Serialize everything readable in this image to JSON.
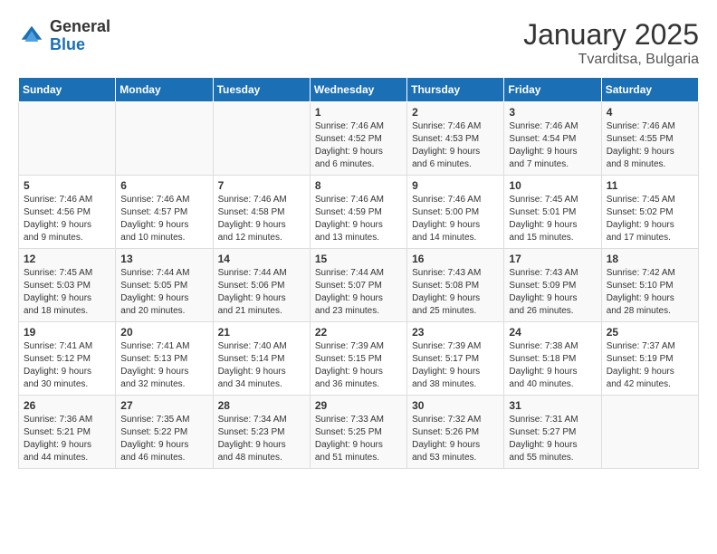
{
  "header": {
    "logo_general": "General",
    "logo_blue": "Blue",
    "title": "January 2025",
    "location": "Tvarditsa, Bulgaria"
  },
  "days_of_week": [
    "Sunday",
    "Monday",
    "Tuesday",
    "Wednesday",
    "Thursday",
    "Friday",
    "Saturday"
  ],
  "weeks": [
    [
      {
        "day": "",
        "info": ""
      },
      {
        "day": "",
        "info": ""
      },
      {
        "day": "",
        "info": ""
      },
      {
        "day": "1",
        "info": "Sunrise: 7:46 AM\nSunset: 4:52 PM\nDaylight: 9 hours\nand 6 minutes."
      },
      {
        "day": "2",
        "info": "Sunrise: 7:46 AM\nSunset: 4:53 PM\nDaylight: 9 hours\nand 6 minutes."
      },
      {
        "day": "3",
        "info": "Sunrise: 7:46 AM\nSunset: 4:54 PM\nDaylight: 9 hours\nand 7 minutes."
      },
      {
        "day": "4",
        "info": "Sunrise: 7:46 AM\nSunset: 4:55 PM\nDaylight: 9 hours\nand 8 minutes."
      }
    ],
    [
      {
        "day": "5",
        "info": "Sunrise: 7:46 AM\nSunset: 4:56 PM\nDaylight: 9 hours\nand 9 minutes."
      },
      {
        "day": "6",
        "info": "Sunrise: 7:46 AM\nSunset: 4:57 PM\nDaylight: 9 hours\nand 10 minutes."
      },
      {
        "day": "7",
        "info": "Sunrise: 7:46 AM\nSunset: 4:58 PM\nDaylight: 9 hours\nand 12 minutes."
      },
      {
        "day": "8",
        "info": "Sunrise: 7:46 AM\nSunset: 4:59 PM\nDaylight: 9 hours\nand 13 minutes."
      },
      {
        "day": "9",
        "info": "Sunrise: 7:46 AM\nSunset: 5:00 PM\nDaylight: 9 hours\nand 14 minutes."
      },
      {
        "day": "10",
        "info": "Sunrise: 7:45 AM\nSunset: 5:01 PM\nDaylight: 9 hours\nand 15 minutes."
      },
      {
        "day": "11",
        "info": "Sunrise: 7:45 AM\nSunset: 5:02 PM\nDaylight: 9 hours\nand 17 minutes."
      }
    ],
    [
      {
        "day": "12",
        "info": "Sunrise: 7:45 AM\nSunset: 5:03 PM\nDaylight: 9 hours\nand 18 minutes."
      },
      {
        "day": "13",
        "info": "Sunrise: 7:44 AM\nSunset: 5:05 PM\nDaylight: 9 hours\nand 20 minutes."
      },
      {
        "day": "14",
        "info": "Sunrise: 7:44 AM\nSunset: 5:06 PM\nDaylight: 9 hours\nand 21 minutes."
      },
      {
        "day": "15",
        "info": "Sunrise: 7:44 AM\nSunset: 5:07 PM\nDaylight: 9 hours\nand 23 minutes."
      },
      {
        "day": "16",
        "info": "Sunrise: 7:43 AM\nSunset: 5:08 PM\nDaylight: 9 hours\nand 25 minutes."
      },
      {
        "day": "17",
        "info": "Sunrise: 7:43 AM\nSunset: 5:09 PM\nDaylight: 9 hours\nand 26 minutes."
      },
      {
        "day": "18",
        "info": "Sunrise: 7:42 AM\nSunset: 5:10 PM\nDaylight: 9 hours\nand 28 minutes."
      }
    ],
    [
      {
        "day": "19",
        "info": "Sunrise: 7:41 AM\nSunset: 5:12 PM\nDaylight: 9 hours\nand 30 minutes."
      },
      {
        "day": "20",
        "info": "Sunrise: 7:41 AM\nSunset: 5:13 PM\nDaylight: 9 hours\nand 32 minutes."
      },
      {
        "day": "21",
        "info": "Sunrise: 7:40 AM\nSunset: 5:14 PM\nDaylight: 9 hours\nand 34 minutes."
      },
      {
        "day": "22",
        "info": "Sunrise: 7:39 AM\nSunset: 5:15 PM\nDaylight: 9 hours\nand 36 minutes."
      },
      {
        "day": "23",
        "info": "Sunrise: 7:39 AM\nSunset: 5:17 PM\nDaylight: 9 hours\nand 38 minutes."
      },
      {
        "day": "24",
        "info": "Sunrise: 7:38 AM\nSunset: 5:18 PM\nDaylight: 9 hours\nand 40 minutes."
      },
      {
        "day": "25",
        "info": "Sunrise: 7:37 AM\nSunset: 5:19 PM\nDaylight: 9 hours\nand 42 minutes."
      }
    ],
    [
      {
        "day": "26",
        "info": "Sunrise: 7:36 AM\nSunset: 5:21 PM\nDaylight: 9 hours\nand 44 minutes."
      },
      {
        "day": "27",
        "info": "Sunrise: 7:35 AM\nSunset: 5:22 PM\nDaylight: 9 hours\nand 46 minutes."
      },
      {
        "day": "28",
        "info": "Sunrise: 7:34 AM\nSunset: 5:23 PM\nDaylight: 9 hours\nand 48 minutes."
      },
      {
        "day": "29",
        "info": "Sunrise: 7:33 AM\nSunset: 5:25 PM\nDaylight: 9 hours\nand 51 minutes."
      },
      {
        "day": "30",
        "info": "Sunrise: 7:32 AM\nSunset: 5:26 PM\nDaylight: 9 hours\nand 53 minutes."
      },
      {
        "day": "31",
        "info": "Sunrise: 7:31 AM\nSunset: 5:27 PM\nDaylight: 9 hours\nand 55 minutes."
      },
      {
        "day": "",
        "info": ""
      }
    ]
  ]
}
